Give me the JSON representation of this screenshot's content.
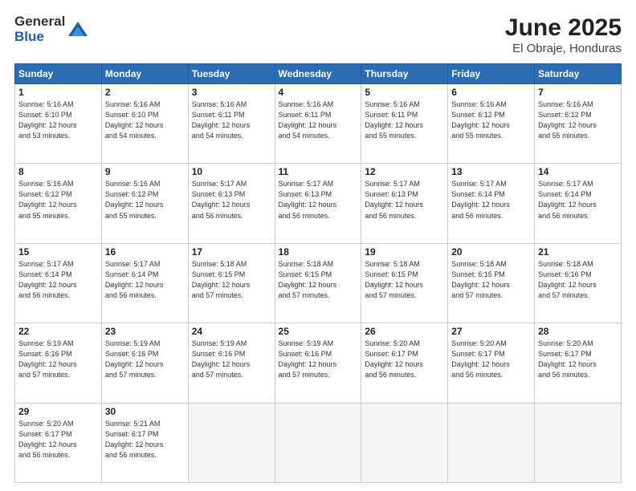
{
  "logo": {
    "general": "General",
    "blue": "Blue"
  },
  "title": "June 2025",
  "location": "El Obraje, Honduras",
  "days_of_week": [
    "Sunday",
    "Monday",
    "Tuesday",
    "Wednesday",
    "Thursday",
    "Friday",
    "Saturday"
  ],
  "weeks": [
    [
      {
        "day": "1",
        "info": "Sunrise: 5:16 AM\nSunset: 6:10 PM\nDaylight: 12 hours\nand 53 minutes."
      },
      {
        "day": "2",
        "info": "Sunrise: 5:16 AM\nSunset: 6:10 PM\nDaylight: 12 hours\nand 54 minutes."
      },
      {
        "day": "3",
        "info": "Sunrise: 5:16 AM\nSunset: 6:11 PM\nDaylight: 12 hours\nand 54 minutes."
      },
      {
        "day": "4",
        "info": "Sunrise: 5:16 AM\nSunset: 6:11 PM\nDaylight: 12 hours\nand 54 minutes."
      },
      {
        "day": "5",
        "info": "Sunrise: 5:16 AM\nSunset: 6:11 PM\nDaylight: 12 hours\nand 55 minutes."
      },
      {
        "day": "6",
        "info": "Sunrise: 5:16 AM\nSunset: 6:12 PM\nDaylight: 12 hours\nand 55 minutes."
      },
      {
        "day": "7",
        "info": "Sunrise: 5:16 AM\nSunset: 6:12 PM\nDaylight: 12 hours\nand 55 minutes."
      }
    ],
    [
      {
        "day": "8",
        "info": "Sunrise: 5:16 AM\nSunset: 6:12 PM\nDaylight: 12 hours\nand 55 minutes."
      },
      {
        "day": "9",
        "info": "Sunrise: 5:16 AM\nSunset: 6:12 PM\nDaylight: 12 hours\nand 55 minutes."
      },
      {
        "day": "10",
        "info": "Sunrise: 5:17 AM\nSunset: 6:13 PM\nDaylight: 12 hours\nand 56 minutes."
      },
      {
        "day": "11",
        "info": "Sunrise: 5:17 AM\nSunset: 6:13 PM\nDaylight: 12 hours\nand 56 minutes."
      },
      {
        "day": "12",
        "info": "Sunrise: 5:17 AM\nSunset: 6:13 PM\nDaylight: 12 hours\nand 56 minutes."
      },
      {
        "day": "13",
        "info": "Sunrise: 5:17 AM\nSunset: 6:14 PM\nDaylight: 12 hours\nand 56 minutes."
      },
      {
        "day": "14",
        "info": "Sunrise: 5:17 AM\nSunset: 6:14 PM\nDaylight: 12 hours\nand 56 minutes."
      }
    ],
    [
      {
        "day": "15",
        "info": "Sunrise: 5:17 AM\nSunset: 6:14 PM\nDaylight: 12 hours\nand 56 minutes."
      },
      {
        "day": "16",
        "info": "Sunrise: 5:17 AM\nSunset: 6:14 PM\nDaylight: 12 hours\nand 56 minutes."
      },
      {
        "day": "17",
        "info": "Sunrise: 5:18 AM\nSunset: 6:15 PM\nDaylight: 12 hours\nand 57 minutes."
      },
      {
        "day": "18",
        "info": "Sunrise: 5:18 AM\nSunset: 6:15 PM\nDaylight: 12 hours\nand 57 minutes."
      },
      {
        "day": "19",
        "info": "Sunrise: 5:18 AM\nSunset: 6:15 PM\nDaylight: 12 hours\nand 57 minutes."
      },
      {
        "day": "20",
        "info": "Sunrise: 5:18 AM\nSunset: 6:15 PM\nDaylight: 12 hours\nand 57 minutes."
      },
      {
        "day": "21",
        "info": "Sunrise: 5:18 AM\nSunset: 6:16 PM\nDaylight: 12 hours\nand 57 minutes."
      }
    ],
    [
      {
        "day": "22",
        "info": "Sunrise: 5:19 AM\nSunset: 6:16 PM\nDaylight: 12 hours\nand 57 minutes."
      },
      {
        "day": "23",
        "info": "Sunrise: 5:19 AM\nSunset: 6:16 PM\nDaylight: 12 hours\nand 57 minutes."
      },
      {
        "day": "24",
        "info": "Sunrise: 5:19 AM\nSunset: 6:16 PM\nDaylight: 12 hours\nand 57 minutes."
      },
      {
        "day": "25",
        "info": "Sunrise: 5:19 AM\nSunset: 6:16 PM\nDaylight: 12 hours\nand 57 minutes."
      },
      {
        "day": "26",
        "info": "Sunrise: 5:20 AM\nSunset: 6:17 PM\nDaylight: 12 hours\nand 56 minutes."
      },
      {
        "day": "27",
        "info": "Sunrise: 5:20 AM\nSunset: 6:17 PM\nDaylight: 12 hours\nand 56 minutes."
      },
      {
        "day": "28",
        "info": "Sunrise: 5:20 AM\nSunset: 6:17 PM\nDaylight: 12 hours\nand 56 minutes."
      }
    ],
    [
      {
        "day": "29",
        "info": "Sunrise: 5:20 AM\nSunset: 6:17 PM\nDaylight: 12 hours\nand 56 minutes."
      },
      {
        "day": "30",
        "info": "Sunrise: 5:21 AM\nSunset: 6:17 PM\nDaylight: 12 hours\nand 56 minutes."
      },
      {
        "day": "",
        "info": ""
      },
      {
        "day": "",
        "info": ""
      },
      {
        "day": "",
        "info": ""
      },
      {
        "day": "",
        "info": ""
      },
      {
        "day": "",
        "info": ""
      }
    ]
  ]
}
